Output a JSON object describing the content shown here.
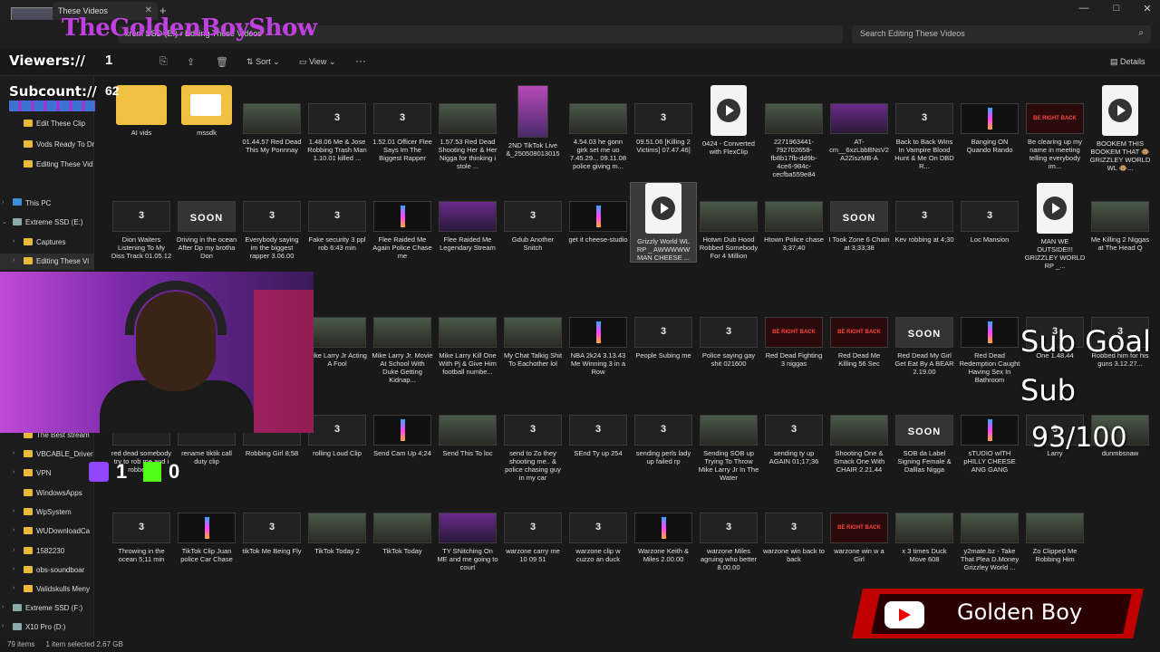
{
  "window": {
    "tab_title": "These Videos",
    "new_tab": "+",
    "minimize": "—",
    "maximize": "□",
    "close": "✕"
  },
  "address": {
    "path": "xrem SSD (E:)  ›  Editing These Videos",
    "search_placeholder": "Search Editing These Videos"
  },
  "toolbar": {
    "sort_label": "Sort",
    "view_label": "View",
    "more_label": "···",
    "details_label": "Details"
  },
  "sidebar": {
    "items": [
      {
        "label": "Edit These Clip",
        "type": "folder"
      },
      {
        "label": "Vods Ready To Dr",
        "type": "folder"
      },
      {
        "label": "Editing These Vid",
        "type": "folder"
      },
      {
        "label": "This PC",
        "type": "pc"
      },
      {
        "label": "Extreme SSD (E:)",
        "type": "drive"
      },
      {
        "label": "Captures",
        "type": "folder"
      },
      {
        "label": "Editing These Vi",
        "type": "folder"
      },
      {
        "label": "The Best stream",
        "type": "folder"
      },
      {
        "label": "VBCABLE_Driver",
        "type": "folder"
      },
      {
        "label": "VPN",
        "type": "folder"
      },
      {
        "label": "WindowsApps",
        "type": "folder"
      },
      {
        "label": "WpSystem",
        "type": "folder"
      },
      {
        "label": "WUDownloadCa",
        "type": "folder"
      },
      {
        "label": "1582230",
        "type": "folder"
      },
      {
        "label": "obs-soundboar",
        "type": "folder"
      },
      {
        "label": "Validskulls Meny",
        "type": "folder"
      },
      {
        "label": "Extreme SSD (F:)",
        "type": "drive"
      },
      {
        "label": "X10 Pro (D:)",
        "type": "drive"
      }
    ]
  },
  "files": {
    "row1": [
      {
        "name": "AI vids",
        "kind": "folder"
      },
      {
        "name": "mssdk",
        "kind": "folder2"
      },
      {
        "name": "01.44.57 Red Dead This My Ponnnay",
        "kind": "scene"
      },
      {
        "name": "1.48.06 Me & Jose Robbing Trash Man 1.10.01 killed ...",
        "kind": "dark"
      },
      {
        "name": "1.52.01 Officer Flee Says Im The Biggest Rapper",
        "kind": "dark"
      },
      {
        "name": "1.57.53 Red Dead Shooting Her & Her Nigga for thinking i stole ...",
        "kind": "scene"
      },
      {
        "name": "2ND TikTok Live &_250508013015",
        "kind": "tall"
      },
      {
        "name": "4.54.03 he gonn girk set me uo 7.45.29... 09.11.08 police giving m...",
        "kind": "scene"
      },
      {
        "name": "09.51.06 [Killing 2 Victims] 07.47.46]",
        "kind": "dark"
      },
      {
        "name": "0424 - Converted with FlexClip",
        "kind": "vid"
      },
      {
        "name": "2271963441-792702658-fb8b17fb-dd9b-4ce6-984c-cecfba559e84",
        "kind": "scene"
      },
      {
        "name": "AT-cm__6xzLbbBNsV2A2ZiszMB-A",
        "kind": "purple"
      },
      {
        "name": "Back to Back Wins In Vampire Blood Hunt & Me On DBD R...",
        "kind": "dark"
      },
      {
        "name": "Banging ON Quando Rando",
        "kind": "neon"
      },
      {
        "name": "Be clearing up my name in meeting telling everybody im...",
        "kind": "brb"
      },
      {
        "name": "BOOKEM THIS BOOKEM THAT 🐵 GRIZZLEY WORLD WL 🐵...",
        "kind": "vid"
      }
    ],
    "row2": [
      {
        "name": "Dion Waiters Listening To My Diss Track 01.05.12",
        "kind": "dark"
      },
      {
        "name": "Driving in the ocean After Dp my brotha Don",
        "kind": "soon"
      },
      {
        "name": "Everybody saying im the biggest rapper 3.06.00",
        "kind": "dark"
      },
      {
        "name": "Fake security 3 ppl rob 6:43 min",
        "kind": "dark"
      },
      {
        "name": "Flee Raided Me Again Police Chase me",
        "kind": "neon"
      },
      {
        "name": "Flee Raided Me Legendary Stream",
        "kind": "purple"
      },
      {
        "name": "Gdub Another Snitch",
        "kind": "dark"
      },
      {
        "name": "get it cheese-studio",
        "kind": "neon"
      },
      {
        "name": "Grizzly World WL RP _ AWWWWW MAN CHEESE ...",
        "kind": "vid"
      },
      {
        "name": "Hotwn Dub Hood Robbed Somebody For 4 Million",
        "kind": "scene"
      },
      {
        "name": "Htown Police chase 3;37;40",
        "kind": "scene"
      },
      {
        "name": "I Took Zone 6 Chain at 3;33;38",
        "kind": "soon"
      },
      {
        "name": "Kev robbing at 4;30",
        "kind": "dark"
      },
      {
        "name": "Loc Mansion",
        "kind": "dark"
      },
      {
        "name": "MAN WE OUTSIDE!!! GRIZZLEY WORLD RP _...",
        "kind": "vid"
      },
      {
        "name": "Me Killing 2 Niggas at The Head Q",
        "kind": "scene"
      }
    ],
    "row3": [
      {
        "name": "Mike Larry Jr Acting A Fool",
        "kind": "scene"
      },
      {
        "name": "Mike Larry Jr. Movie At School With Duke Getting Kidnap...",
        "kind": "scene"
      },
      {
        "name": "Mike Larry Kill One With Pj & Give Him football numbe...",
        "kind": "scene"
      },
      {
        "name": "My Chat Talkig Shit To Eachother lol",
        "kind": "scene"
      },
      {
        "name": "NBA 2k24 3.13.43 Me Winning 3 in a Row",
        "kind": "neon"
      },
      {
        "name": "People Subing me",
        "kind": "dark"
      },
      {
        "name": "Police saying gay shit 021600",
        "kind": "dark"
      },
      {
        "name": "Red Dead Fighting 3 niggas",
        "kind": "brb"
      },
      {
        "name": "Red Dead Me Killing 56 Sec",
        "kind": "brb"
      },
      {
        "name": "Red Dead My Girl Get Eat By A BEAR 2.19.00",
        "kind": "soon"
      },
      {
        "name": "Red Dead Redemption Caught Having Sex In Bathroom",
        "kind": "neon"
      },
      {
        "name": "One 1.48.44",
        "kind": "dark"
      },
      {
        "name": "Robbed him for his guns 3.12.27...",
        "kind": "dark"
      }
    ],
    "row4": [
      {
        "name": "red dead somebody try to rob me and i robbed...",
        "kind": "dark"
      },
      {
        "name": "rename tiktik call duty clip",
        "kind": "dark"
      },
      {
        "name": "Robbing Girl 8;58",
        "kind": "dark"
      },
      {
        "name": "rolling Loud Clip",
        "kind": "dark"
      },
      {
        "name": "Send Cam Up 4;24",
        "kind": "neon"
      },
      {
        "name": "Send This To loc",
        "kind": "scene"
      },
      {
        "name": "send to Zo they shooting me.. & police chasing guy in my car",
        "kind": "dark"
      },
      {
        "name": "SEnd Ty up 254",
        "kind": "dark"
      },
      {
        "name": "sending perls lady up failed rp",
        "kind": "dark"
      },
      {
        "name": "Sending SOB up Trying To Throw Mike Larry Jr In The Water",
        "kind": "scene"
      },
      {
        "name": "sending ty up AGAIN 01;17;36",
        "kind": "dark"
      },
      {
        "name": "Shooting One & Smack One With CHAIR 2.21.44",
        "kind": "scene"
      },
      {
        "name": "SOB da Label Signing Female & Dalllas Nigga",
        "kind": "soon"
      },
      {
        "name": "sTUDIO wITH pHILLY CHEESE ANG GANG",
        "kind": "neon"
      },
      {
        "name": "Larry",
        "kind": "dark"
      },
      {
        "name": "dunmbsnaw",
        "kind": "scene"
      }
    ],
    "row5": [
      {
        "name": "Throwing in the ocean 5;11 min",
        "kind": "dark"
      },
      {
        "name": "TikTok Clip Juan police Car Chase",
        "kind": "neon"
      },
      {
        "name": "tikTok Me Being Fly",
        "kind": "dark"
      },
      {
        "name": "TikTok Today 2",
        "kind": "scene"
      },
      {
        "name": "TikTok Today",
        "kind": "scene"
      },
      {
        "name": "TY SNitching On ME and me going to court",
        "kind": "purple"
      },
      {
        "name": "warzone carry me 10 09 51",
        "kind": "dark"
      },
      {
        "name": "warzone clip w cuzzo an duck",
        "kind": "dark"
      },
      {
        "name": "Warzone Keith & Miles 2.00.00",
        "kind": "neon"
      },
      {
        "name": "warzone Miles agruing who better 8.00.00",
        "kind": "dark"
      },
      {
        "name": "warzone win back to back",
        "kind": "dark"
      },
      {
        "name": "warzone win w a Girl",
        "kind": "brb"
      },
      {
        "name": "x 3 times Duck Move 608",
        "kind": "scene"
      },
      {
        "name": "y2mate.bz - Take That Plea D.Money Grizzley World ...",
        "kind": "scene"
      },
      {
        "name": "Zo Clipped Me Robbing Him",
        "kind": "scene"
      }
    ]
  },
  "thumb_glyphs": {
    "dark": "3",
    "soon": "SOON",
    "brb": "BE RIGHT BACK"
  },
  "overlay": {
    "brand": "TheGoldenBoyShow",
    "viewers_label": "Viewers://",
    "viewers_count": "1",
    "subcount_label": "Subcount://",
    "subcount_value": "62",
    "twitch_count": "1",
    "kick_count": "0",
    "subgoal_title": "Sub Goal",
    "subgoal_sub": "Sub",
    "subgoal_progress": "93/100",
    "yt_name": "Golden Boy",
    "accent": "#c040e0"
  },
  "status": {
    "items_count": "79 items",
    "selected": "1 item selected  2.67 GB"
  }
}
